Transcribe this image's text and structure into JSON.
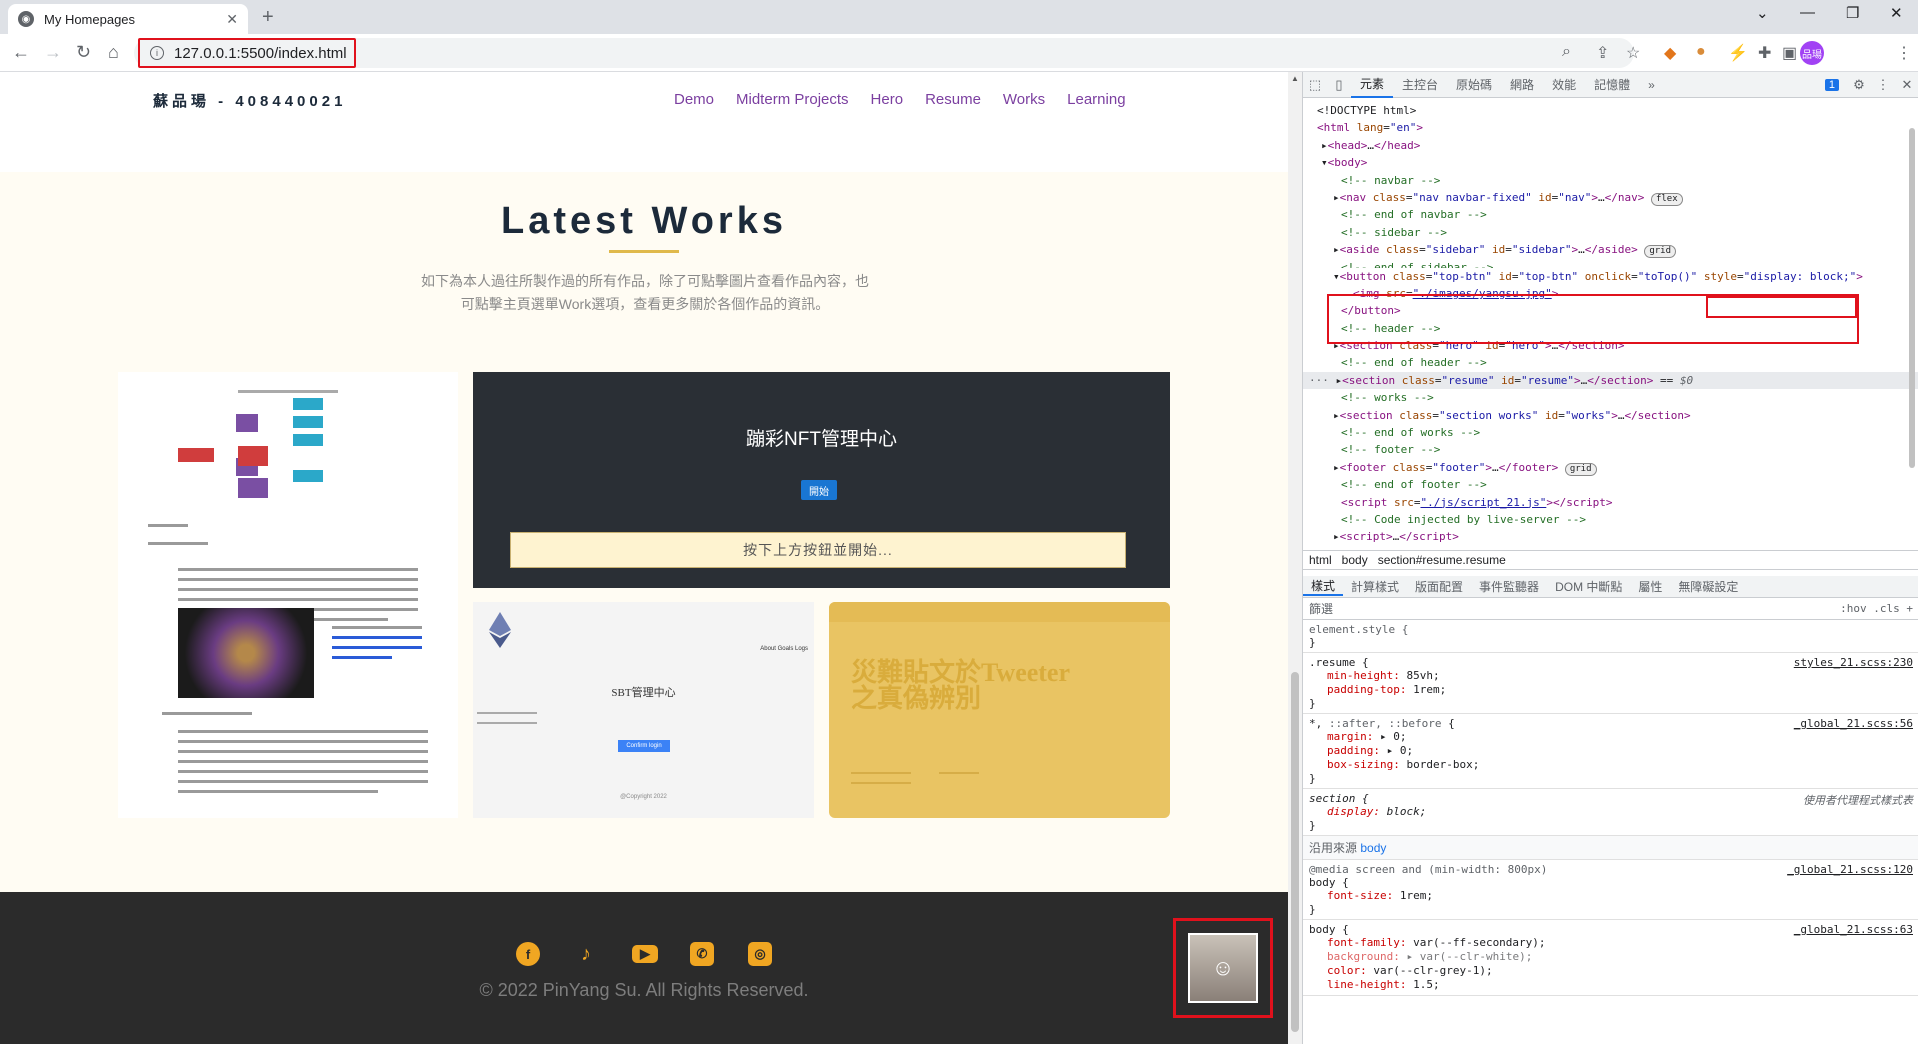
{
  "browser": {
    "tab_title": "My Homepages",
    "new_tab": "+",
    "url": "127.0.0.1:5500/index.html",
    "profile_badge": "品瑒"
  },
  "page": {
    "brand": "蘇品瑒 - 408440021",
    "nav": [
      "Demo",
      "Midterm Projects",
      "Hero",
      "Resume",
      "Works",
      "Learning"
    ],
    "works_title": "Latest Works",
    "works_desc": "如下為本人過往所製作過的所有作品，除了可點擊圖片查看作品內容，也可點擊主頁選單Work選項，查看更多關於各個作品的資訊。",
    "card_nft": {
      "title": "蹦彩NFT管理中心",
      "button": "開始",
      "bar": "按下上方按鈕並開始..."
    },
    "card_sbt": {
      "title": "SBT管理中心",
      "nav": "About  Goals  Logs",
      "button": "Confirm login",
      "footer": "@Copyright 2022"
    },
    "card_disaster": {
      "title": "災難貼文於Tweeter之真偽辨別"
    },
    "footer": {
      "copyright": "© 2022 PinYang Su. All Rights Reserved."
    }
  },
  "devtools": {
    "tabs": [
      "元素",
      "主控台",
      "原始碼",
      "網路",
      "效能",
      "記憶體",
      "»"
    ],
    "issues_badge": "1",
    "breadcrumbs": [
      "html",
      "body",
      "section#resume.resume"
    ],
    "style_tabs": [
      "樣式",
      "計算樣式",
      "版面配置",
      "事件監聽器",
      "DOM 中斷點",
      "屬性",
      "無障礙設定"
    ],
    "filter_placeholder": "篩選",
    "filter_tools": ":hov  .cls  +",
    "inherited_label": "沿用來源",
    "inherited_from": "body"
  }
}
